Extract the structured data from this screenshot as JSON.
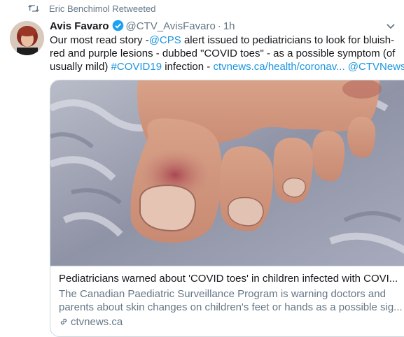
{
  "retweet": {
    "text": "Eric Benchimol Retweeted"
  },
  "tweet": {
    "author_name": "Avis Favaro",
    "handle": "@CTV_AvisFavaro",
    "separator": "·",
    "time": "1h",
    "text_lines": {
      "l1_a": "Our most read story -",
      "l1_mention": "@CPS",
      "l1_b": " alert issued to pediatricians to look for bluish-",
      "l2": "red and purple lesions - dubbed \"COVID toes\" - as a possible symptom (of",
      "l3_a": "usually mild) ",
      "l3_hashtag": "#COVID19",
      "l3_b": " infection - ",
      "l3_link": "ctvnews.ca/health/coronav...",
      "l3_space": " ",
      "l3_mention": "@CTVNews"
    }
  },
  "card": {
    "title": "Pediatricians warned about 'COVID toes' in children infected with COVI...",
    "desc_line1": "The Canadian Paediatric Surveillance Program is warning doctors and",
    "desc_line2": "parents about skin changes on children's feet or hands as a possible sig...",
    "domain": "ctvnews.ca",
    "image_icon": "photo-of-toes"
  },
  "colors": {
    "link": "#1b95e0",
    "secondary": "#657786",
    "verified": "#1da1f2"
  }
}
